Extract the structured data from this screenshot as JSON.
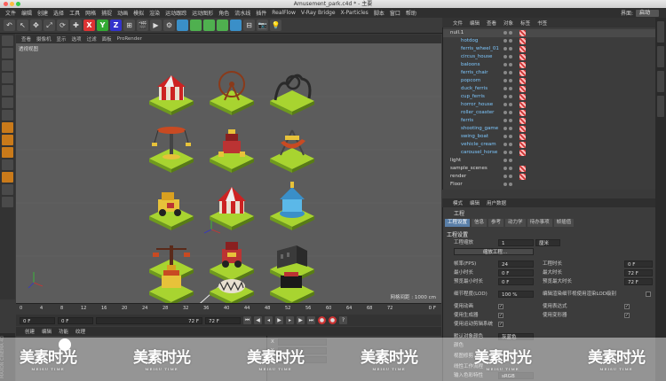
{
  "window": {
    "title": "Amusement_park.c4d * - 主要"
  },
  "menubar": [
    "文件",
    "编辑",
    "创建",
    "选择",
    "工具",
    "网格",
    "捕捉",
    "动画",
    "模拟",
    "渲染",
    "运动跟踪",
    "运动图形",
    "角色",
    "流水线",
    "插件",
    "RealFlow",
    "V-Ray Bridge",
    "X-Particles",
    "脚本",
    "窗口",
    "帮助"
  ],
  "layout": {
    "label": "界面:",
    "value": "启动"
  },
  "toolbar": {
    "x": "X",
    "y": "Y",
    "z": "Z"
  },
  "viewport": {
    "menu": [
      "查看",
      "摄像机",
      "显示",
      "选项",
      "过滤",
      "面板",
      "ProRender"
    ],
    "label": "透视视图",
    "grid_info": "网格间距 : 1000 cm"
  },
  "timeline": {
    "ticks": [
      "0",
      "4",
      "8",
      "12",
      "16",
      "20",
      "24",
      "28",
      "32",
      "36",
      "40",
      "44",
      "48",
      "52",
      "56",
      "60",
      "64",
      "68",
      "72"
    ],
    "frame_end": "0 F"
  },
  "transport": {
    "start": "0 F",
    "end": "72 F",
    "end2": "72 F"
  },
  "material": {
    "menu": [
      "创建",
      "编辑",
      "功能",
      "纹理"
    ],
    "brand": "MAXON CINEMA 4D"
  },
  "coords": {
    "x": "X",
    "y": "Y",
    "z": "Z"
  },
  "object_manager": {
    "menu": [
      "文件",
      "编辑",
      "查看",
      "对象",
      "标签",
      "书签"
    ],
    "objects": [
      "null.1",
      "hotdog",
      "ferris_wheel_01",
      "circus_house",
      "baloons",
      "ferris_chair",
      "popcorn",
      "duck_ferris",
      "cup_ferris",
      "horror_house",
      "roller_coaster",
      "ferris",
      "shooting_game",
      "swing_boat",
      "vehicle_cream",
      "carousel_horse",
      "light",
      "sample_scenes",
      "render",
      "Floor"
    ]
  },
  "attributes": {
    "menu": [
      "模式",
      "编辑",
      "用户数据"
    ],
    "title": "工程",
    "tabs": [
      "工程设置",
      "信息",
      "参考",
      "动力学",
      "待办事项",
      "帧插值"
    ],
    "section": "工程设置",
    "rows": {
      "scale": {
        "label": "工程缩放",
        "value": "1",
        "unit": "厘米"
      },
      "scale_btn": "缩放工程...",
      "fps": {
        "label": "帧率(FPS)",
        "value": "24"
      },
      "project_len": {
        "label": "工程时长",
        "value": "0 F"
      },
      "min_len": {
        "label": "最小时长",
        "value": "0 F"
      },
      "max_len": {
        "label": "最大时长",
        "value": "72 F"
      },
      "prev_min": {
        "label": "预览最小时长",
        "value": "0 F"
      },
      "prev_max": {
        "label": "预览最大时长",
        "value": "72 F"
      },
      "lod": {
        "label": "细节程度(LOD)",
        "value": "100 %"
      },
      "lod_render": {
        "label": "编辑渲染细节视使用渲染LOD级别"
      },
      "use_anim": {
        "label": "使用动画"
      },
      "use_expr": {
        "label": "使用表达式"
      },
      "use_gen": {
        "label": "使用生成器"
      },
      "use_deform": {
        "label": "使用变形器"
      },
      "use_motion": {
        "label": "使用运动剪辑系统"
      },
      "default_color": {
        "label": "默认对象颜色",
        "value": "灰蓝色"
      },
      "color": {
        "label": "颜色"
      },
      "view_clip": {
        "label": "视图修剪"
      },
      "linear": {
        "label": "线性工作流程"
      },
      "input_color": {
        "label": "输入色彩特性",
        "value": "sRGB"
      }
    }
  },
  "watermark": {
    "text": "美素时光",
    "sub": "MEISU TIME",
    "count": 6
  }
}
